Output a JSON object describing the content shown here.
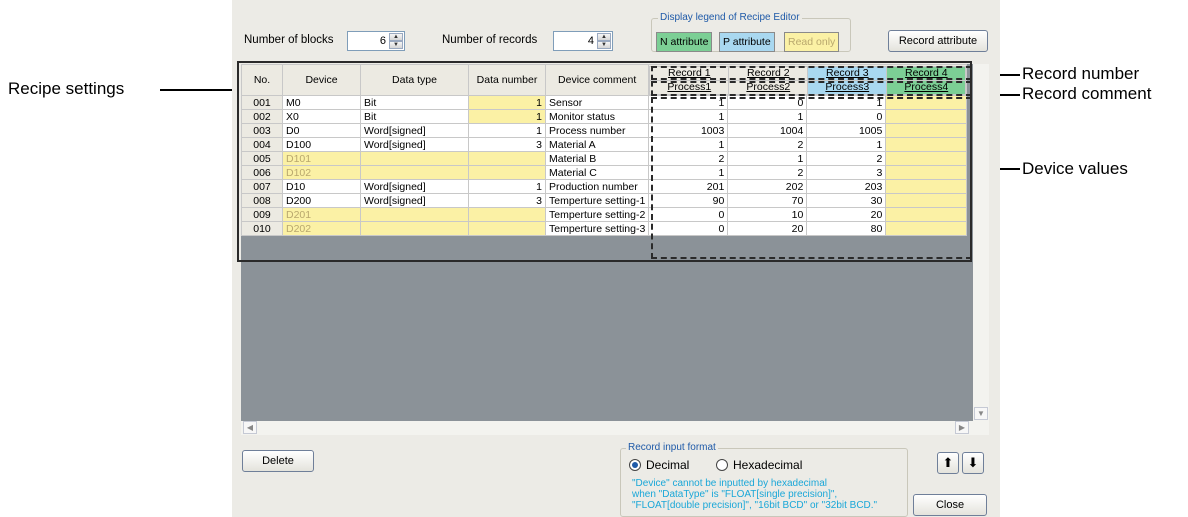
{
  "callouts": {
    "recipe_settings": "Recipe settings",
    "record_number": "Record number",
    "record_comment": "Record comment",
    "device_values": "Device values"
  },
  "top": {
    "blocks_label": "Number of blocks",
    "blocks_value": "6",
    "records_label": "Number of records",
    "records_value": "4",
    "legend_title": "Display legend of Recipe Editor",
    "legend_n": "N attribute",
    "legend_p": "P attribute",
    "legend_ro": "Read only",
    "record_attribute_button": "Record attribute"
  },
  "columns": {
    "no": "No.",
    "device": "Device",
    "data_type": "Data type",
    "data_number": "Data number",
    "device_comment": "Device comment"
  },
  "records": [
    {
      "number": "Record 1",
      "comment": "Process1",
      "attr": "N"
    },
    {
      "number": "Record 2",
      "comment": "Process2",
      "attr": "N"
    },
    {
      "number": "Record 3",
      "comment": "Process3",
      "attr": "P"
    },
    {
      "number": "Record 4",
      "comment": "Process4",
      "attr": "N-color"
    }
  ],
  "rows": [
    {
      "no": "001",
      "device": "M0",
      "type": "Bit",
      "dnum": "1",
      "comment": "Sensor",
      "v": [
        "1",
        "0",
        "1",
        ""
      ],
      "ro_device": false,
      "ro_dnum": true
    },
    {
      "no": "002",
      "device": "X0",
      "type": "Bit",
      "dnum": "1",
      "comment": "Monitor status",
      "v": [
        "1",
        "1",
        "0",
        ""
      ],
      "ro_device": false,
      "ro_dnum": true
    },
    {
      "no": "003",
      "device": "D0",
      "type": "Word[signed]",
      "dnum": "1",
      "comment": "Process number",
      "v": [
        "1003",
        "1004",
        "1005",
        ""
      ],
      "ro_device": false,
      "ro_dnum": false
    },
    {
      "no": "004",
      "device": "D100",
      "type": "Word[signed]",
      "dnum": "3",
      "comment": "Material A",
      "v": [
        "1",
        "2",
        "1",
        ""
      ],
      "ro_device": false,
      "ro_dnum": false
    },
    {
      "no": "005",
      "device": "D101",
      "type": "",
      "dnum": "",
      "comment": "Material B",
      "v": [
        "2",
        "1",
        "2",
        ""
      ],
      "ro_device": true,
      "ro_dnum": true
    },
    {
      "no": "006",
      "device": "D102",
      "type": "",
      "dnum": "",
      "comment": "Material C",
      "v": [
        "1",
        "2",
        "3",
        ""
      ],
      "ro_device": true,
      "ro_dnum": true
    },
    {
      "no": "007",
      "device": "D10",
      "type": "Word[signed]",
      "dnum": "1",
      "comment": "Production number",
      "v": [
        "201",
        "202",
        "203",
        ""
      ],
      "ro_device": false,
      "ro_dnum": false
    },
    {
      "no": "008",
      "device": "D200",
      "type": "Word[signed]",
      "dnum": "3",
      "comment": "Temperture setting-1",
      "v": [
        "90",
        "70",
        "30",
        ""
      ],
      "ro_device": false,
      "ro_dnum": false
    },
    {
      "no": "009",
      "device": "D201",
      "type": "",
      "dnum": "",
      "comment": "Temperture setting-2",
      "v": [
        "0",
        "10",
        "20",
        ""
      ],
      "ro_device": true,
      "ro_dnum": true
    },
    {
      "no": "010",
      "device": "D202",
      "type": "",
      "dnum": "",
      "comment": "Temperture setting-3",
      "v": [
        "0",
        "20",
        "80",
        ""
      ],
      "ro_device": true,
      "ro_dnum": true
    }
  ],
  "bottom": {
    "delete_button": "Delete",
    "input_format_title": "Record input format",
    "decimal": "Decimal",
    "hexadecimal": "Hexadecimal",
    "selected": "Decimal",
    "note_lines": [
      "\"Device\" cannot be inputted by hexadecimal",
      "when \"DataType\" is \"FLOAT[single precision]\",",
      "\"FLOAT[double precision]\", \"16bit BCD\" or \"32bit BCD.\""
    ],
    "close_button": "Close"
  },
  "colors": {
    "n_attribute": "#7ccf95",
    "p_attribute": "#a9d8f0",
    "read_only": "#fbf1a5"
  }
}
